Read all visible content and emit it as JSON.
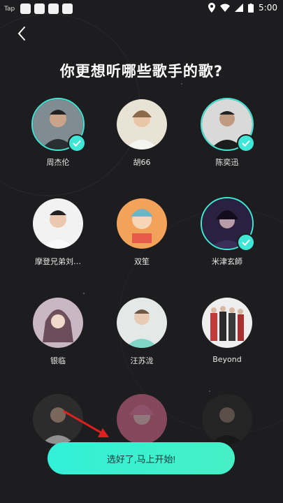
{
  "status_bar": {
    "app": "Tap",
    "time": "5:00"
  },
  "page": {
    "title": "你更想听哪些歌手的歌?"
  },
  "singers": [
    {
      "name": "周杰伦",
      "selected": true
    },
    {
      "name": "胡66",
      "selected": false
    },
    {
      "name": "陈奕迅",
      "selected": true
    },
    {
      "name": "摩登兄弟刘…",
      "selected": false
    },
    {
      "name": "双笙",
      "selected": false
    },
    {
      "name": "米津玄師",
      "selected": true
    },
    {
      "name": "银临",
      "selected": false
    },
    {
      "name": "汪苏泷",
      "selected": false
    },
    {
      "name": "Beyond",
      "selected": false
    },
    {
      "name": "",
      "selected": false
    },
    {
      "name": "",
      "selected": false
    },
    {
      "name": "",
      "selected": false
    }
  ],
  "cta": {
    "label": "选好了,马上开始!"
  },
  "colors": {
    "accent": "#3fe7d6",
    "background": "#1d1d1f",
    "arrow": "#e02020"
  }
}
